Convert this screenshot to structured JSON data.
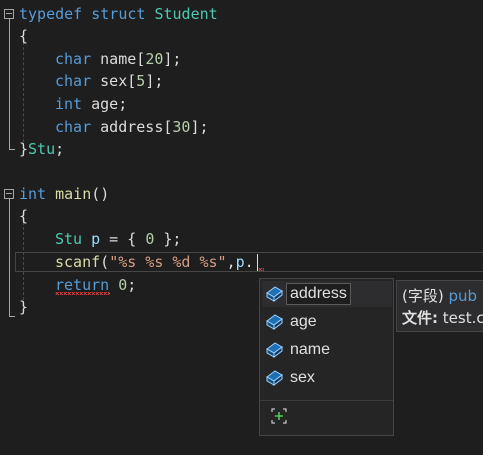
{
  "code": {
    "line1": {
      "kw1": "typedef",
      "kw2": "struct",
      "name": "Student"
    },
    "line2": {
      "brace": "{"
    },
    "line3": {
      "type": "char",
      "field": "name",
      "size": "20",
      "open": "[",
      "close": "];"
    },
    "line4": {
      "type": "char",
      "field": "sex",
      "size": "5",
      "open": "[",
      "close": "];"
    },
    "line5": {
      "type": "int",
      "field": "age",
      "end": ";"
    },
    "line6": {
      "type": "char",
      "field": "address",
      "size": "30",
      "open": "[",
      "close": "];"
    },
    "line7": {
      "brace": "}",
      "alias": "Stu",
      "end": ";"
    },
    "line9": {
      "type": "int",
      "fn": "main",
      "parens": "()"
    },
    "line10": {
      "brace": "{"
    },
    "line11": {
      "type": "Stu",
      "var": "p",
      "rest1": " = { ",
      "zero": "0",
      "rest2": " };"
    },
    "line12": {
      "fn": "scanf",
      "open": "(",
      "fmt": "\"%s %s %d %s\"",
      "comma": ",",
      "var": "p",
      "dot": "."
    },
    "line13": {
      "kw": "return",
      "zero": "0",
      "end": ";"
    },
    "line14": {
      "brace": "}"
    }
  },
  "completion": {
    "items": [
      {
        "label": "address",
        "icon": "field-icon",
        "selected": true
      },
      {
        "label": "age",
        "icon": "field-icon"
      },
      {
        "label": "name",
        "icon": "field-icon"
      },
      {
        "label": "sex",
        "icon": "field-icon"
      }
    ],
    "footer_icon": "expand-filter-icon"
  },
  "quickinfo": {
    "line1_prefix": "(字段)",
    "line1_kw": "pub",
    "line2_label": "文件:",
    "line2_value": "test.c"
  },
  "colors": {
    "background": "#1e1e1e",
    "keyword": "#569cd6",
    "type": "#4ec9b0",
    "function": "#dcdcaa",
    "number": "#b5cea8",
    "string": "#d69d85",
    "variable": "#9cdcfe",
    "error": "#f14c4c"
  }
}
